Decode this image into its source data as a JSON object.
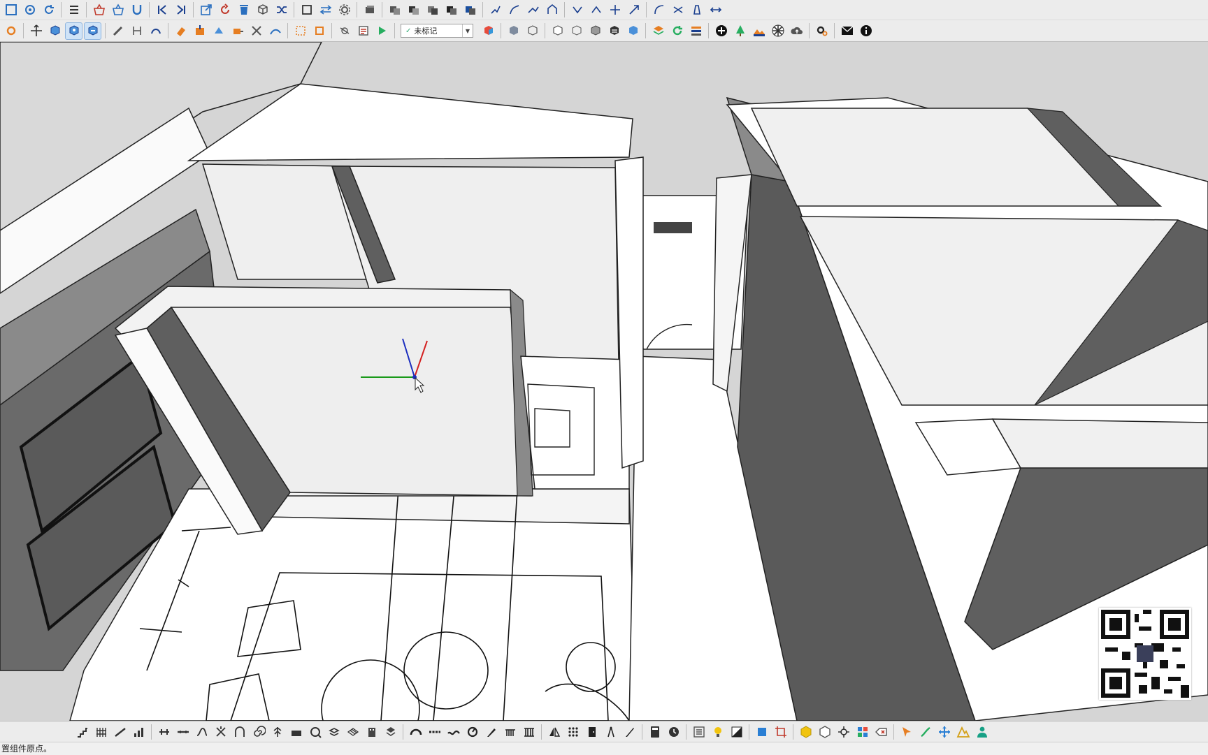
{
  "toolbar": {
    "tag_selector": {
      "value": "未标记"
    }
  },
  "status_bar": {
    "text": "置组件原点。"
  },
  "colors": {
    "wall_face": "#f2f2f2",
    "wall_shadow": "#5f5f5f",
    "wall_mid": "#8a8a8a",
    "floor": "#ffffff",
    "axis_red": "#d42020",
    "axis_green": "#1a9a1a",
    "axis_blue": "#1d2fbf"
  },
  "icons": {
    "top_row": [
      "select-icon",
      "components-icon",
      "refresh-icon",
      "outliner-icon",
      "basket-delete-icon",
      "basket-icon",
      "magnet-icon",
      "start-icon",
      "end-icon",
      "export-icon",
      "rotate-icon",
      "trash-icon",
      "box-icon",
      "shuffle-icon",
      "frame-icon",
      "arrows-icon",
      "gear-icon"
    ],
    "bottom_row": [
      "stair-icon",
      "fence-icon",
      "ruler-icon",
      "chart-icon",
      "road-icon",
      "line-icon",
      "path-icon",
      "spiral-icon",
      "bulb-icon",
      "contrast-icon",
      "cube-icon",
      "hexagon-icon",
      "hexagon-outline-icon",
      "target-icon",
      "grid-icon",
      "erase-icon",
      "cursor-icon",
      "tool-icon",
      "move-icon",
      "mountain-icon",
      "person-icon"
    ]
  }
}
